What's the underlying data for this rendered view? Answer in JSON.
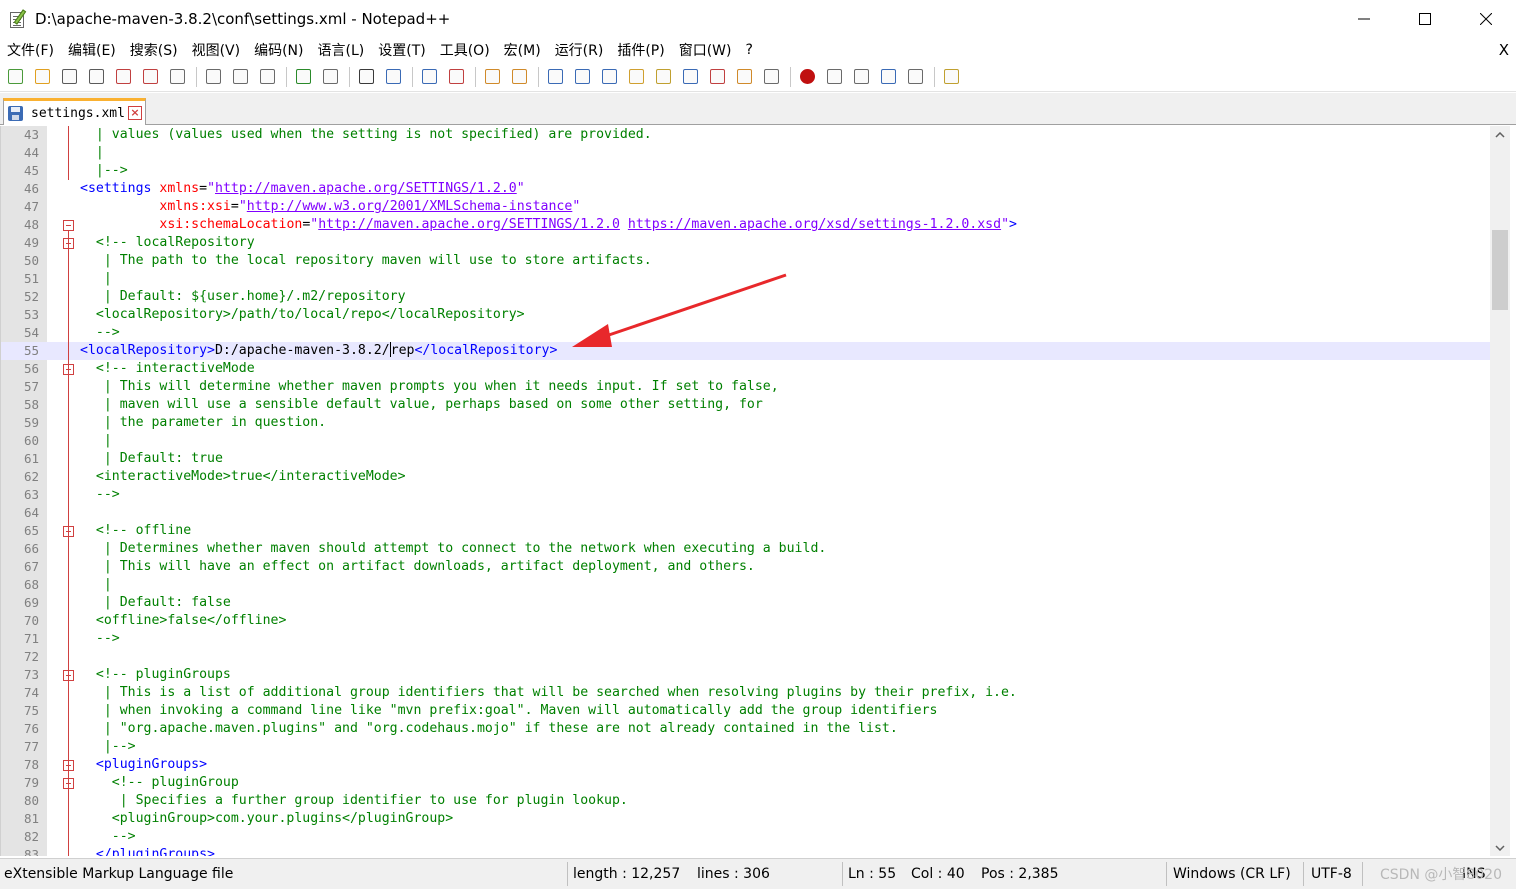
{
  "window": {
    "title": "D:\\apache-maven-3.8.2\\conf\\settings.xml - Notepad++",
    "minimize_icon": "minimize-icon",
    "maximize_icon": "maximize-icon",
    "close_icon": "close-icon"
  },
  "menu": {
    "items": [
      "文件(F)",
      "编辑(E)",
      "搜索(S)",
      "视图(V)",
      "编码(N)",
      "语言(L)",
      "设置(T)",
      "工具(O)",
      "宏(M)",
      "运行(R)",
      "插件(P)",
      "窗口(W)",
      "?"
    ],
    "close_label": "X"
  },
  "toolbar": {
    "icons": [
      "new-file-icon",
      "open-file-icon",
      "save-icon",
      "save-all-icon",
      "close-icon",
      "close-all-icon",
      "print-icon",
      "cut-icon",
      "copy-icon",
      "paste-icon",
      "undo-icon",
      "redo-icon",
      "find-icon",
      "replace-icon",
      "zoom-in-icon",
      "zoom-out-icon",
      "sync-vertical-icon",
      "sync-horizontal-icon",
      "word-wrap-icon",
      "show-all-chars-icon",
      "indent-guide-icon",
      "user-defined-language-icon",
      "doc-map-icon",
      "doc-list-icon",
      "function-list-icon",
      "folder-as-workspace-icon",
      "monitoring-icon",
      "record-macro-icon",
      "stop-macro-icon",
      "play-macro-icon",
      "run-macro-multiple-icon",
      "save-macro-icon",
      "plugin-icon"
    ]
  },
  "tab": {
    "label": "settings.xml",
    "close_label": "×"
  },
  "editor": {
    "current_line": 55,
    "lines": [
      {
        "n": "43",
        "segs": [
          [
            "com",
            "  | values (values used when the setting is not specified) are provided."
          ]
        ]
      },
      {
        "n": "44",
        "segs": [
          [
            "com",
            "  |"
          ]
        ]
      },
      {
        "n": "45",
        "segs": [
          [
            "com",
            "  |-->"
          ]
        ]
      },
      {
        "n": "46",
        "segs": [
          [
            "tag",
            "<settings "
          ],
          [
            "attr",
            "xmlns"
          ],
          [
            "txt",
            "="
          ],
          [
            "str",
            "\""
          ],
          [
            "url",
            "http://maven.apache.org/SETTINGS/1.2.0"
          ],
          [
            "str",
            "\""
          ]
        ]
      },
      {
        "n": "47",
        "segs": [
          [
            "txt",
            "          "
          ],
          [
            "attr",
            "xmlns:xsi"
          ],
          [
            "txt",
            "="
          ],
          [
            "str",
            "\""
          ],
          [
            "url",
            "http://www.w3.org/2001/XMLSchema-instance"
          ],
          [
            "str",
            "\""
          ]
        ]
      },
      {
        "n": "48",
        "segs": [
          [
            "txt",
            "          "
          ],
          [
            "attr",
            "xsi:schemaLocation"
          ],
          [
            "txt",
            "="
          ],
          [
            "str",
            "\""
          ],
          [
            "url",
            "http://maven.apache.org/SETTINGS/1.2.0"
          ],
          [
            "str",
            " "
          ],
          [
            "url",
            "https://maven.apache.org/xsd/settings-1.2.0.xsd"
          ],
          [
            "str",
            "\""
          ],
          [
            "tag",
            ">"
          ]
        ]
      },
      {
        "n": "49",
        "segs": [
          [
            "com",
            "  <!-- localRepository"
          ]
        ]
      },
      {
        "n": "50",
        "segs": [
          [
            "com",
            "   | The path to the local repository maven will use to store artifacts."
          ]
        ]
      },
      {
        "n": "51",
        "segs": [
          [
            "com",
            "   |"
          ]
        ]
      },
      {
        "n": "52",
        "segs": [
          [
            "com",
            "   | Default: ${user.home}/.m2/repository"
          ]
        ]
      },
      {
        "n": "53",
        "segs": [
          [
            "com",
            "  <localRepository>/path/to/local/repo</localRepository>"
          ]
        ]
      },
      {
        "n": "54",
        "segs": [
          [
            "com",
            "  -->"
          ]
        ]
      },
      {
        "n": "55",
        "segs": [
          [
            "tag",
            "<localRepository>"
          ],
          [
            "txt",
            "D:/apache-maven-3.8.2/"
          ],
          [
            "caret",
            ""
          ],
          [
            "txt",
            "rep"
          ],
          [
            "tag",
            "</localRepository>"
          ]
        ]
      },
      {
        "n": "56",
        "segs": [
          [
            "com",
            "  <!-- interactiveMode"
          ]
        ]
      },
      {
        "n": "57",
        "segs": [
          [
            "com",
            "   | This will determine whether maven prompts you when it needs input. If set to false,"
          ]
        ]
      },
      {
        "n": "58",
        "segs": [
          [
            "com",
            "   | maven will use a sensible default value, perhaps based on some other setting, for"
          ]
        ]
      },
      {
        "n": "59",
        "segs": [
          [
            "com",
            "   | the parameter in question."
          ]
        ]
      },
      {
        "n": "60",
        "segs": [
          [
            "com",
            "   |"
          ]
        ]
      },
      {
        "n": "61",
        "segs": [
          [
            "com",
            "   | Default: true"
          ]
        ]
      },
      {
        "n": "62",
        "segs": [
          [
            "com",
            "  <interactiveMode>true</interactiveMode>"
          ]
        ]
      },
      {
        "n": "63",
        "segs": [
          [
            "com",
            "  -->"
          ]
        ]
      },
      {
        "n": "64",
        "segs": [
          [
            "txt",
            ""
          ]
        ]
      },
      {
        "n": "65",
        "segs": [
          [
            "com",
            "  <!-- offline"
          ]
        ]
      },
      {
        "n": "66",
        "segs": [
          [
            "com",
            "   | Determines whether maven should attempt to connect to the network when executing a build."
          ]
        ]
      },
      {
        "n": "67",
        "segs": [
          [
            "com",
            "   | This will have an effect on artifact downloads, artifact deployment, and others."
          ]
        ]
      },
      {
        "n": "68",
        "segs": [
          [
            "com",
            "   |"
          ]
        ]
      },
      {
        "n": "69",
        "segs": [
          [
            "com",
            "   | Default: false"
          ]
        ]
      },
      {
        "n": "70",
        "segs": [
          [
            "com",
            "  <offline>false</offline>"
          ]
        ]
      },
      {
        "n": "71",
        "segs": [
          [
            "com",
            "  -->"
          ]
        ]
      },
      {
        "n": "72",
        "segs": [
          [
            "txt",
            ""
          ]
        ]
      },
      {
        "n": "73",
        "segs": [
          [
            "com",
            "  <!-- pluginGroups"
          ]
        ]
      },
      {
        "n": "74",
        "segs": [
          [
            "com",
            "   | This is a list of additional group identifiers that will be searched when resolving plugins by their prefix, i.e."
          ]
        ]
      },
      {
        "n": "75",
        "segs": [
          [
            "com",
            "   | when invoking a command line like \"mvn prefix:goal\". Maven will automatically add the group identifiers"
          ]
        ]
      },
      {
        "n": "76",
        "segs": [
          [
            "com",
            "   | \"org.apache.maven.plugins\" and \"org.codehaus.mojo\" if these are not already contained in the list."
          ]
        ]
      },
      {
        "n": "77",
        "segs": [
          [
            "com",
            "   |-->"
          ]
        ]
      },
      {
        "n": "78",
        "segs": [
          [
            "tag",
            "  <pluginGroups>"
          ]
        ]
      },
      {
        "n": "79",
        "segs": [
          [
            "com",
            "    <!-- pluginGroup"
          ]
        ]
      },
      {
        "n": "80",
        "segs": [
          [
            "com",
            "     | Specifies a further group identifier to use for plugin lookup."
          ]
        ]
      },
      {
        "n": "81",
        "segs": [
          [
            "com",
            "    <pluginGroup>com.your.plugins</pluginGroup>"
          ]
        ]
      },
      {
        "n": "82",
        "segs": [
          [
            "com",
            "    -->"
          ]
        ]
      },
      {
        "n": "83",
        "segs": [
          [
            "tag",
            "  </pluginGroups>"
          ]
        ]
      }
    ],
    "fold_lines": [
      "48",
      "49",
      "56",
      "65",
      "73",
      "78",
      "79"
    ]
  },
  "status": {
    "language": "eXtensible Markup Language file",
    "length": "length : 12,257",
    "lines": "lines : 306",
    "ln": "Ln : 55",
    "col": "Col : 40",
    "pos": "Pos : 2,385",
    "eol": "Windows (CR LF)",
    "encoding": "UTF-8",
    "mode": "INS",
    "watermark": "CSDN @小智8020"
  },
  "colors": {
    "comment": "#008000",
    "tag": "#0000ff",
    "attribute": "#ff0000",
    "string": "#8000ff",
    "current_line": "#e8e8ff",
    "arrow": "#e8282b",
    "tab_accent": "#fab131"
  }
}
